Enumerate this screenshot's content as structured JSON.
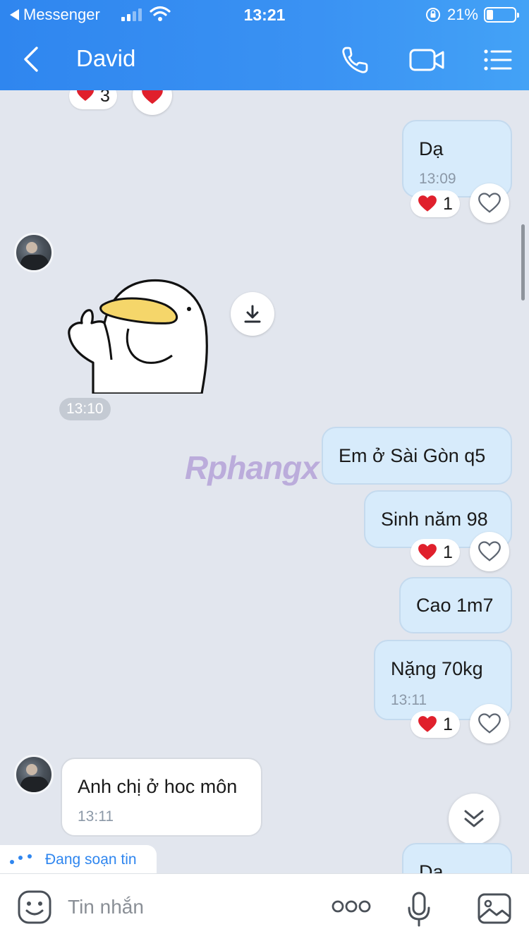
{
  "status_bar": {
    "back_app_label": "Messenger",
    "time": "13:21",
    "battery": "21%",
    "battery_level": 0.21
  },
  "nav": {
    "title": "David",
    "icons": [
      "back-icon",
      "phone-icon",
      "video-call-icon",
      "menu-icon"
    ]
  },
  "messages": {
    "top_reaction": {
      "emoji": "heart",
      "count": "3"
    },
    "m1": {
      "text": "Dạ",
      "time": "13:09",
      "reaction_count": "1"
    },
    "sticker": {
      "time": "13:10"
    },
    "m2": {
      "text": "Em ở Sài Gòn q5"
    },
    "m3": {
      "text": "Sinh năm 98",
      "reaction_count": "1"
    },
    "m4": {
      "text": "Cao 1m7"
    },
    "m5": {
      "text": "Nặng 70kg",
      "time": "13:11",
      "reaction_count": "1"
    },
    "m6": {
      "text": "Anh chị ở hoc môn",
      "time": "13:11"
    },
    "m7": {
      "text": "Dạ"
    }
  },
  "typing_indicator": "Đang soạn tin",
  "watermark": "Rphangx",
  "composer": {
    "placeholder": "Tin nhắn"
  },
  "colors": {
    "header": "#2f86ef",
    "outgoing_bubble": "#d7ebfb",
    "incoming_bubble": "#ffffff",
    "background": "#e2e6ee",
    "heart": "#e0202c"
  }
}
